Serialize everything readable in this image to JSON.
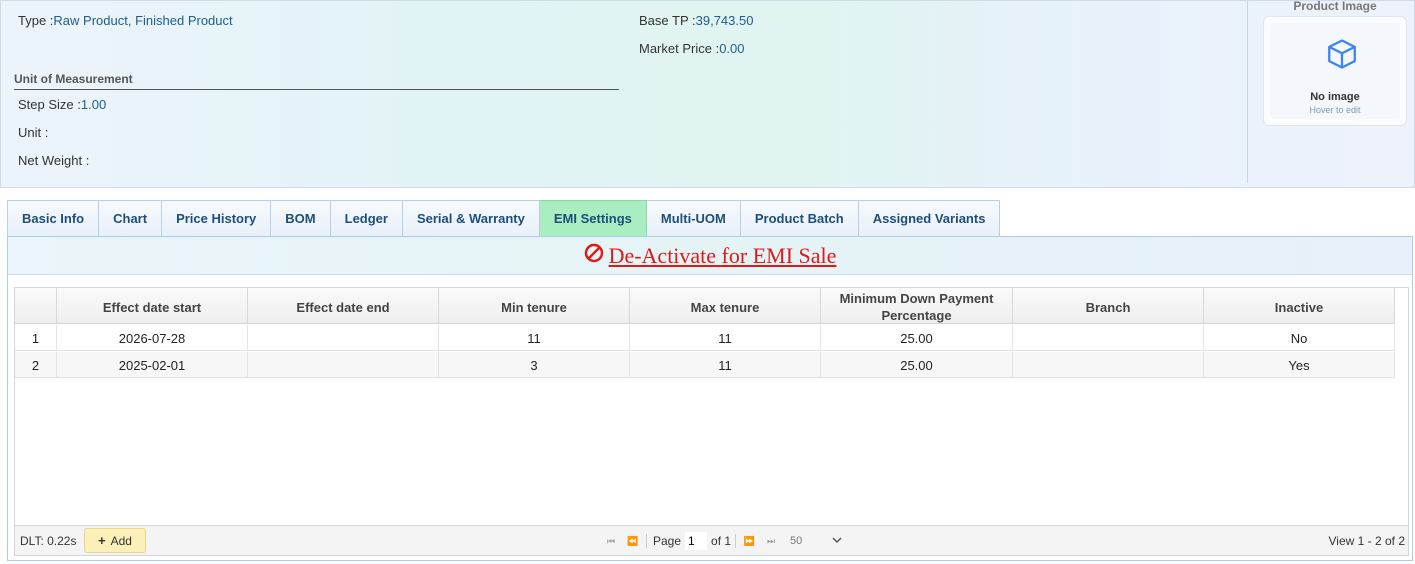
{
  "product": {
    "type_label": "Type",
    "type_value": "Raw Product, Finished Product",
    "base_tp_label": "Base TP",
    "base_tp_value": "39,743.50",
    "market_price_label": "Market Price",
    "market_price_value": "0.00"
  },
  "uom": {
    "title": "Unit of Measurement",
    "step_size_label": "Step Size",
    "step_size_value": "1.00",
    "unit_label": "Unit",
    "unit_value": "",
    "net_weight_label": "Net Weight",
    "net_weight_value": ""
  },
  "image": {
    "title": "Product Image",
    "no_image": "No image",
    "hover_hint": "Hover to edit",
    "icon": "cube-icon"
  },
  "tabs": [
    {
      "label": "Basic Info",
      "active": false
    },
    {
      "label": "Chart",
      "active": false
    },
    {
      "label": "Price History",
      "active": false
    },
    {
      "label": "BOM",
      "active": false
    },
    {
      "label": "Ledger",
      "active": false
    },
    {
      "label": "Serial & Warranty",
      "active": false
    },
    {
      "label": "EMI Settings",
      "active": true
    },
    {
      "label": "Multi-UOM",
      "active": false
    },
    {
      "label": "Product Batch",
      "active": false
    },
    {
      "label": "Assigned Variants",
      "active": false
    }
  ],
  "emi": {
    "deactivate_label": "De-Activate for EMI Sale",
    "deactivate_icon": "ban-icon",
    "columns": [
      "",
      "Effect date start",
      "Effect date end",
      "Min tenure",
      "Max tenure",
      "Minimum Down Payment Percentage",
      "Branch",
      "Inactive"
    ],
    "rows": [
      [
        "1",
        "2026-07-28",
        "",
        "11",
        "11",
        "25.00",
        "",
        "No"
      ],
      [
        "2",
        "2025-02-01",
        "",
        "3",
        "11",
        "25.00",
        "",
        "Yes"
      ]
    ],
    "footer": {
      "dlt": "DLT: 0.22s",
      "add_label": "Add",
      "page_label": "Page",
      "page_value": "1",
      "of_label": "of 1",
      "page_size": "50",
      "view_info": "View 1 - 2 of 2"
    }
  },
  "colors": {
    "active_tab": "#a8eec0",
    "link_red": "#e01818",
    "value_blue": "#1f5d8c",
    "add_button": "#fbf0b8"
  }
}
